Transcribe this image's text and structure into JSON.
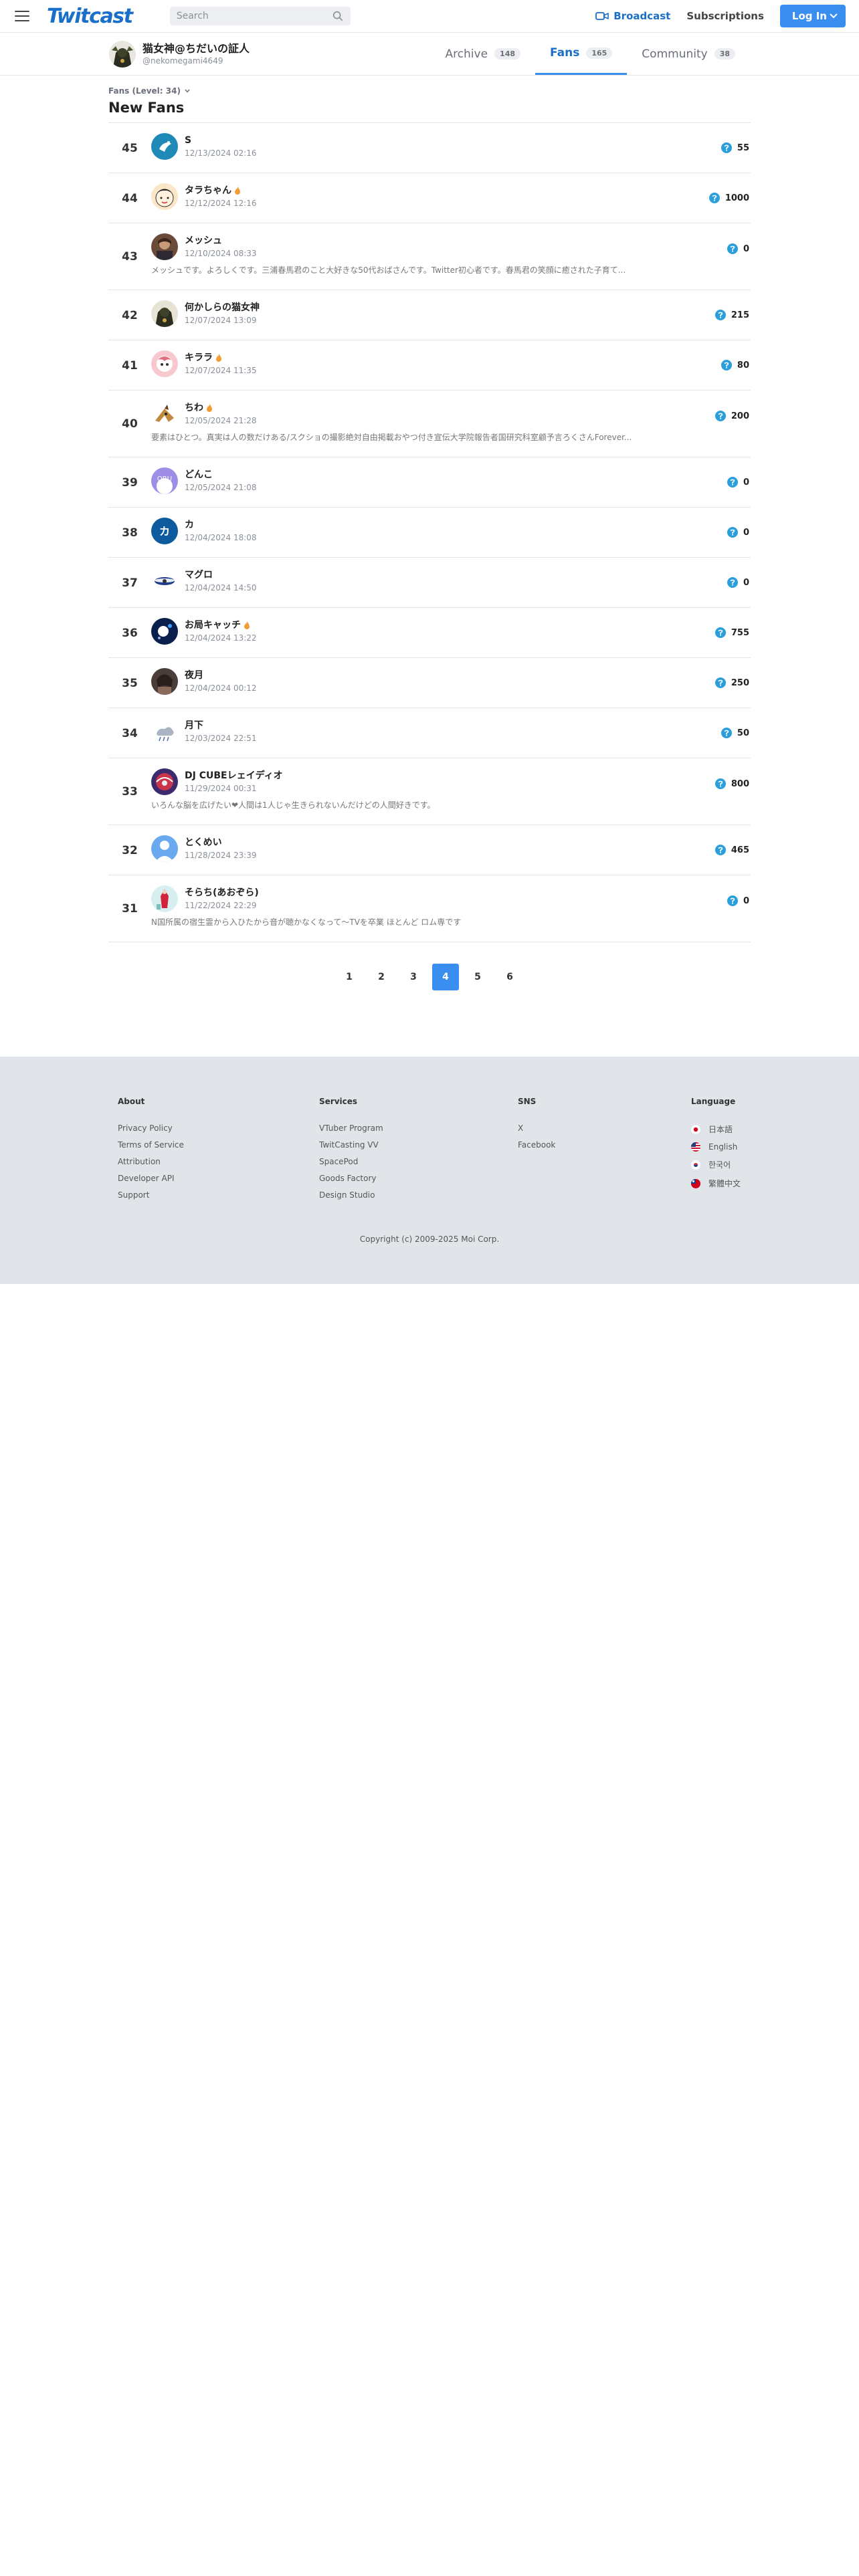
{
  "header": {
    "logo": "Twitcast",
    "search_placeholder": "Search",
    "broadcast_label": "Broadcast",
    "subscriptions_label": "Subscriptions",
    "login_label": "Log In"
  },
  "profile": {
    "name": "猫女神@ちだいの証人",
    "handle": "@nekomegami4649"
  },
  "tabs": [
    {
      "label": "Archive",
      "count": "148"
    },
    {
      "label": "Fans",
      "count": "165"
    },
    {
      "label": "Community",
      "count": "38"
    }
  ],
  "level_label": "Fans (Level: 34)",
  "section_title": "New Fans",
  "fans": [
    {
      "rank": "45",
      "name": "S",
      "date": "12/13/2024 02:16",
      "points": "55",
      "bio": ""
    },
    {
      "rank": "44",
      "name": "タラちゃん",
      "date": "12/12/2024 12:16",
      "points": "1000",
      "bio": ""
    },
    {
      "rank": "43",
      "name": "メッシュ",
      "date": "12/10/2024 08:33",
      "points": "0",
      "bio": "メッシュです。よろしくです。三浦春馬君のこと大好きな50代おばさんです。Twitter初心者です。春馬君の笑顔に癒された子育て..."
    },
    {
      "rank": "42",
      "name": "何かしらの猫女神",
      "date": "12/07/2024 13:09",
      "points": "215",
      "bio": ""
    },
    {
      "rank": "41",
      "name": "キララ",
      "date": "12/07/2024 11:35",
      "points": "80",
      "bio": ""
    },
    {
      "rank": "40",
      "name": "ちわ",
      "date": "12/05/2024 21:28",
      "points": "200",
      "bio": "要素はひとつ。真実は人の数だけある/スクショの撮影絶対自由掲載おやつ付き宣伝大学院報告者国研究科室顧予言ろくさんForever..."
    },
    {
      "rank": "39",
      "name": "どんこ",
      "date": "12/05/2024 21:08",
      "points": "0",
      "bio": ""
    },
    {
      "rank": "38",
      "name": "カ",
      "date": "12/04/2024 18:08",
      "points": "0",
      "bio": ""
    },
    {
      "rank": "37",
      "name": "マグロ",
      "date": "12/04/2024 14:50",
      "points": "0",
      "bio": ""
    },
    {
      "rank": "36",
      "name": "お局キャッチ",
      "date": "12/04/2024 13:22",
      "points": "755",
      "bio": ""
    },
    {
      "rank": "35",
      "name": "夜月",
      "date": "12/04/2024 00:12",
      "points": "250",
      "bio": ""
    },
    {
      "rank": "34",
      "name": "月下",
      "date": "12/03/2024 22:51",
      "points": "50",
      "bio": ""
    },
    {
      "rank": "33",
      "name": "DJ CUBEレェイディオ",
      "date": "11/29/2024 00:31",
      "points": "800",
      "bio": "いろんな脳を広げたい❤人間は1人じゃ生きられないんだけどの人間好きです。"
    },
    {
      "rank": "32",
      "name": "とくめい",
      "date": "11/28/2024 23:39",
      "points": "465",
      "bio": ""
    },
    {
      "rank": "31",
      "name": "そらち(あおぞら)",
      "date": "11/22/2024 22:29",
      "points": "0",
      "bio": "N国所属の宿生霊から入ひたから音が聴かなくなって〜TVを卒業 ほとんど ロム専です"
    }
  ],
  "pages": [
    "1",
    "2",
    "3",
    "4",
    "5",
    "6"
  ],
  "current_page": "4",
  "footer": {
    "about": {
      "title": "About",
      "links": [
        "Privacy Policy",
        "Terms of Service",
        "Attribution",
        "Developer API",
        "Support"
      ]
    },
    "services": {
      "title": "Services",
      "links": [
        "VTuber Program",
        "TwitCasting VV",
        "SpacePod",
        "Goods Factory",
        "Design Studio"
      ]
    },
    "sns": {
      "title": "SNS",
      "links": [
        "X",
        "Facebook"
      ]
    },
    "language": {
      "title": "Language",
      "links": [
        "日本語",
        "English",
        "한국어",
        "繁體中文"
      ]
    },
    "copyright": "Copyright (c) 2009-2025 Moi Corp."
  },
  "colors": {
    "accent": "#3a8ef0",
    "logo": "#1a6fc9",
    "coin": "#2b9fdb",
    "footer_bg": "#e1e5e9"
  }
}
